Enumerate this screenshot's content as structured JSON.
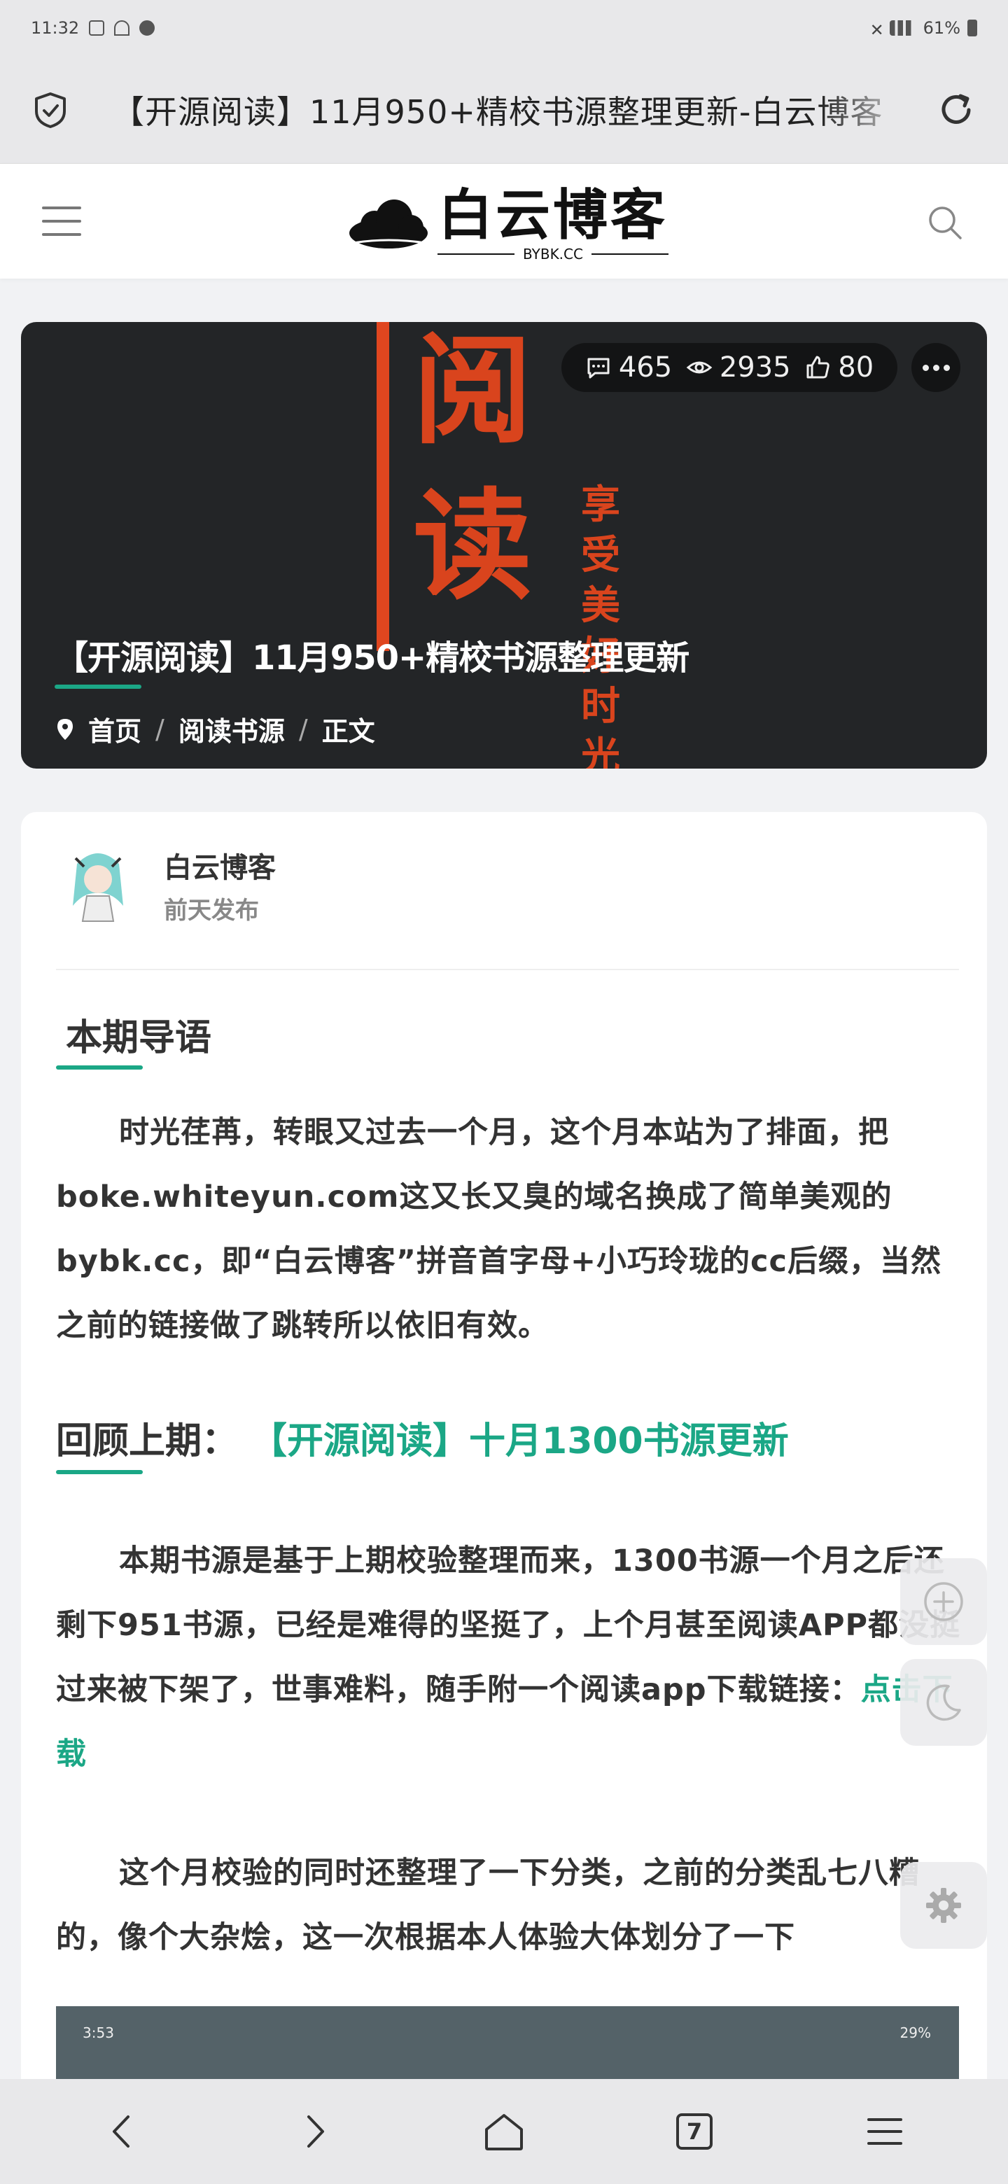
{
  "status_bar": {
    "time": "11:32",
    "battery": "61%"
  },
  "browser": {
    "page_title": "【开源阅读】11月950+精校书源整理更新-白云博客",
    "tab_count": "7"
  },
  "site": {
    "logo_text": "白云博客",
    "logo_sub": "BYBK.CC"
  },
  "hero": {
    "title": "【开源阅读】11月950+精校书源整理更新",
    "comments": "465",
    "views": "2935",
    "likes": "80",
    "big_chars": [
      "阅",
      "读"
    ],
    "small_chars": [
      "享",
      "受",
      "美",
      "好",
      "时",
      "光"
    ],
    "breadcrumb": [
      "首页",
      "阅读书源",
      "正文"
    ]
  },
  "post": {
    "author": "白云博客",
    "time": "前天发布",
    "section1_title": "本期导语",
    "para1": "时光荏苒，转眼又过去一个月，这个月本站为了排面，把boke.whiteyun.com这又长又臭的域名换成了简单美观的bybk.cc，即“白云博客”拼音首字母+小巧玲珑的cc后缀，当然之前的链接做了跳转所以依旧有效。",
    "section2_title": "回顾上期：",
    "section2_link": "【开源阅读】十月1300书源更新",
    "para2": "本期书源是基于上期校验整理而来，1300书源一个月之后还剩下951书源，已经是难得的坚挺了，上个月甚至阅读APP都没挺过来被下架了，世事难料，随手附一个阅读app下载链接：",
    "para2_link": "点击下载",
    "para3": "这个月校验的同时还整理了一下分类，之前的分类乱七八糟的，像个大杂烩，这一次根据本人体验大体划分了一下",
    "screenshot_time": "3:53",
    "screenshot_battery": "29%"
  },
  "colors": {
    "accent": "#1ba786",
    "hero_red": "#d9441d",
    "hero_bg": "#232527"
  }
}
